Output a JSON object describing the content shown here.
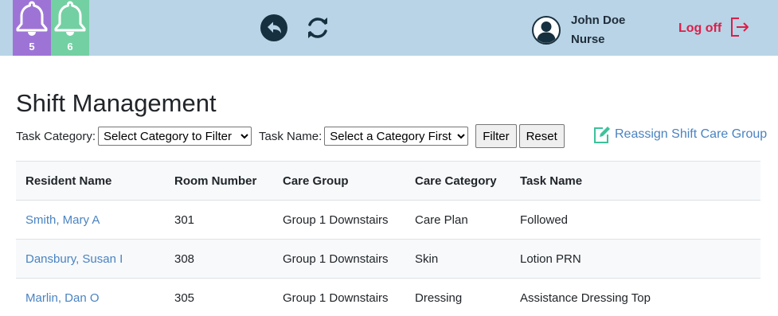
{
  "header": {
    "notifications": [
      {
        "count": "5",
        "color": "#9d74d6",
        "icon": "bell-icon"
      },
      {
        "count": "6",
        "color": "#73d0a3",
        "icon": "bell-icon"
      }
    ],
    "user": {
      "name": "John Doe",
      "role": "Nurse"
    },
    "logoff_label": "Log off",
    "background": "#b9d4e6"
  },
  "page": {
    "title": "Shift Management"
  },
  "filters": {
    "category_label": "Task Category:",
    "category_selected": "Select Category to Filter",
    "name_label": "Task Name:",
    "name_selected": "Select a Category First",
    "filter_button": "Filter",
    "reset_button": "Reset",
    "reassign_link": "Reassign Shift Care Group"
  },
  "table": {
    "columns": [
      "Resident Name",
      "Room Number",
      "Care Group",
      "Care Category",
      "Task Name"
    ],
    "rows": [
      [
        "Smith, Mary A",
        "301",
        "Group 1 Downstairs",
        "Care Plan",
        "Followed"
      ],
      [
        "Dansbury, Susan I",
        "308",
        "Group 1 Downstairs",
        "Skin",
        "Lotion PRN"
      ],
      [
        "Marlin, Dan O",
        "305",
        "Group 1 Downstairs",
        "Dressing",
        "Assistance Dressing Top"
      ]
    ]
  },
  "colors": {
    "accent_link": "#4a83c1",
    "logoff": "#dc1e4a",
    "icon_dark": "#17303f"
  }
}
